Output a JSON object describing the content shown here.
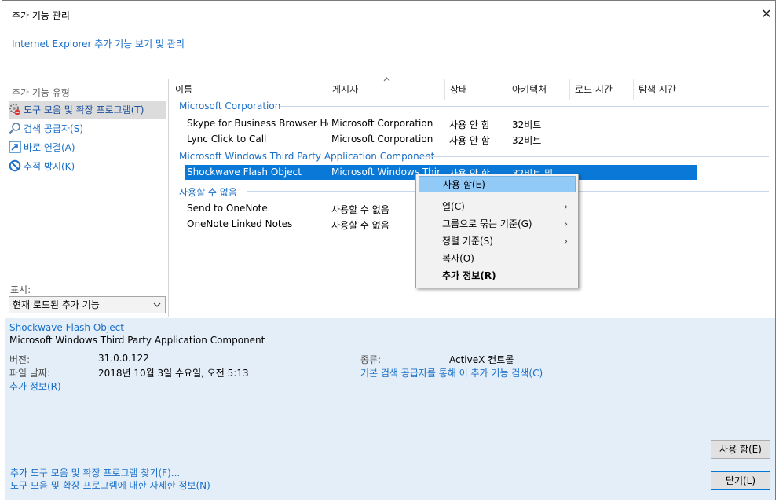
{
  "window": {
    "title": "추가 기능 관리",
    "close_glyph": "✕",
    "subtitle": "Internet Explorer 추가 기능 보기 및 관리"
  },
  "sidebar": {
    "type_label": "추가 기능 유형",
    "items": [
      {
        "label": "도구 모음 및 확장 프로그램(T)",
        "icon": "gear-icon",
        "selected": true
      },
      {
        "label": "검색 공급자(S)",
        "icon": "search-icon",
        "selected": false
      },
      {
        "label": "바로 연결(A)",
        "icon": "accelerator-icon",
        "selected": false
      },
      {
        "label": "추적 방지(K)",
        "icon": "tracking-protection-icon",
        "selected": false
      }
    ],
    "show_label": "표시:",
    "show_value": "현재 로드된 추가 기능"
  },
  "list": {
    "columns": [
      "이름",
      "게시자",
      "상태",
      "아키텍처",
      "로드 시간",
      "탐색 시간"
    ],
    "groups": [
      {
        "name": "Microsoft Corporation",
        "rows": [
          {
            "name": "Skype for Business Browser He...",
            "publisher": "Microsoft Corporation",
            "status": "사용 안 함",
            "arch": "32비트"
          },
          {
            "name": "Lync Click to Call",
            "publisher": "Microsoft Corporation",
            "status": "사용 안 함",
            "arch": "32비트"
          }
        ]
      },
      {
        "name": "Microsoft Windows Third Party Application Component",
        "rows": [
          {
            "name": "Shockwave Flash Object",
            "publisher": "Microsoft Windows Thir",
            "status": "사용 안 함",
            "arch": "32비트 및..."
          }
        ]
      },
      {
        "name": "사용할 수 없음",
        "rows": [
          {
            "name": "Send to OneNote",
            "publisher": "사용할 수 없음",
            "status": "",
            "arch": ""
          },
          {
            "name": "OneNote Linked Notes",
            "publisher": "사용할 수 없음",
            "status": "",
            "arch": ""
          }
        ]
      }
    ]
  },
  "context_menu": {
    "items": [
      {
        "label": "사용 함(E)",
        "highlighted": true,
        "submenu": false,
        "bold": false
      },
      {
        "label": "열(C)",
        "highlighted": false,
        "submenu": true,
        "bold": false
      },
      {
        "label": "그룹으로 묶는 기준(G)",
        "highlighted": false,
        "submenu": true,
        "bold": false
      },
      {
        "label": "정렬 기준(S)",
        "highlighted": false,
        "submenu": true,
        "bold": false
      },
      {
        "label": "복사(O)",
        "highlighted": false,
        "submenu": false,
        "bold": false
      },
      {
        "label": "추가 정보(R)",
        "highlighted": false,
        "submenu": false,
        "bold": true
      }
    ]
  },
  "details": {
    "name": "Shockwave Flash Object",
    "publisher": "Microsoft Windows Third Party Application Component",
    "version_label": "버전:",
    "version": "31.0.0.122",
    "date_label": "파일 날짜:",
    "date": "2018년 10월 3일 수요일, 오전 5:13",
    "more_info": "추가 정보(R)",
    "type_label": "종류:",
    "type": "ActiveX 컨트롤",
    "search_link": "기본 검색 공급자를 통해 이 추가 기능 검색(C)",
    "enable_button": "사용 함(E)",
    "close_button": "닫기(L)",
    "footer_link1": "추가 도구 모음 및 확장 프로그램 찾기(F)...",
    "footer_link2": "도구 모음 및 확장 프로그램에 대한 자세한 정보(N)"
  },
  "colors": {
    "accent": "#1a6fc7",
    "selection": "#0a78d7",
    "details_bg": "#e4eef9",
    "menu_highlight": "#91c9f7"
  }
}
